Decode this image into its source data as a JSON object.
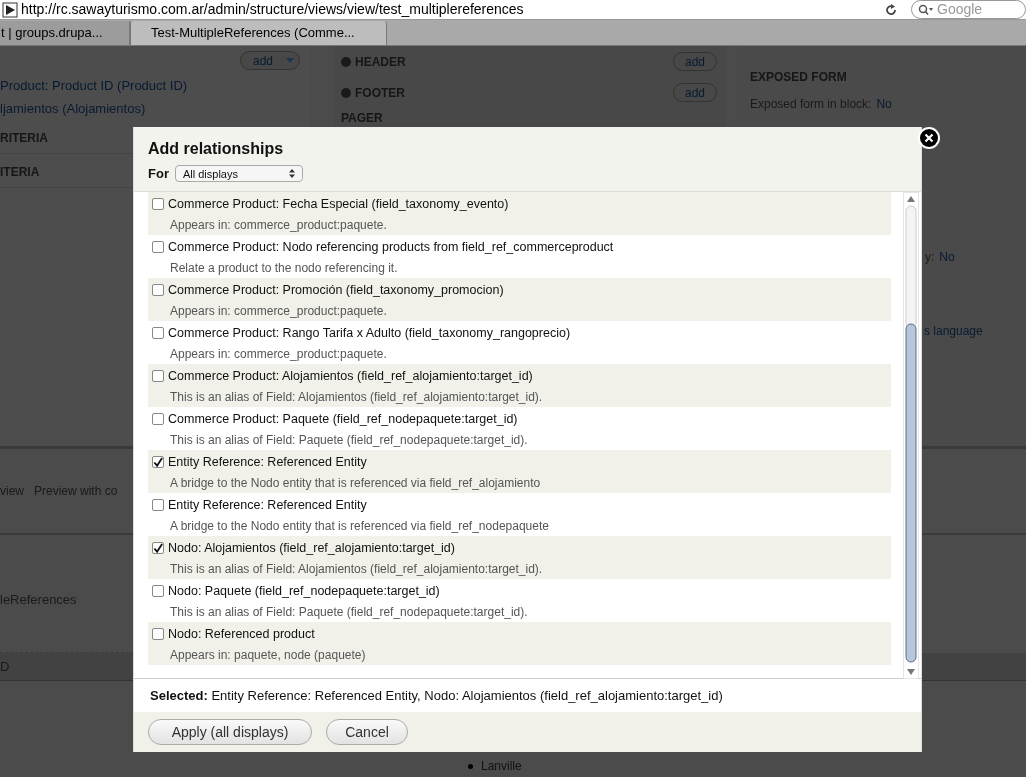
{
  "browser": {
    "url": "http://rc.sawayturismo.com.ar/admin/structure/views/view/test_multiplereferences",
    "search_placeholder": "Google",
    "tabs": [
      {
        "label": "t | groups.drupa...",
        "selected": false
      },
      {
        "label": "Test-MultipleReferences (Comme...",
        "selected": true
      }
    ]
  },
  "background": {
    "left": {
      "add_button": "add",
      "items": [
        "Product: Product ID (Product ID)",
        "ljamientos (Alojamientos)"
      ],
      "headings": [
        "RITERIA",
        "ITERIA"
      ]
    },
    "middle": {
      "sections": [
        {
          "title": "HEADER",
          "button": "add"
        },
        {
          "title": "FOOTER",
          "button": "add"
        }
      ],
      "heading": "PAGER"
    },
    "right": {
      "heading": "EXPOSED FORM",
      "rows": [
        {
          "label": "Exposed form in block:",
          "links": [
            "No"
          ]
        }
      ],
      "fragments": [
        {
          "label": "y:",
          "link": "No"
        },
        {
          "link": "s language"
        }
      ]
    },
    "bottom": {
      "tabs": [
        "view",
        "Preview with co"
      ],
      "title": "leReferences",
      "row": "D",
      "bullet": "Lanville"
    }
  },
  "dialog": {
    "title": "Add relationships",
    "for_label": "For",
    "for_value": "All displays",
    "options": [
      {
        "label": "Commerce Product: Fecha Especial (field_taxonomy_evento)",
        "description": "Appears in: commerce_product:paquete.",
        "checked": false
      },
      {
        "label": "Commerce Product: Nodo referencing products from field_ref_commerceproduct",
        "description": "Relate a product to the nodo referencing it.",
        "checked": false
      },
      {
        "label": "Commerce Product: Promoción (field_taxonomy_promocion)",
        "description": "Appears in: commerce_product:paquete.",
        "checked": false
      },
      {
        "label": "Commerce Product: Rango Tarifa x Adulto (field_taxonomy_rangoprecio)",
        "description": "Appears in: commerce_product:paquete.",
        "checked": false
      },
      {
        "label": "Commerce Product: Alojamientos (field_ref_alojamiento:target_id)",
        "description": "This is an alias of Field: Alojamientos (field_ref_alojamiento:target_id).",
        "checked": false
      },
      {
        "label": "Commerce Product: Paquete (field_ref_nodepaquete:target_id)",
        "description": "This is an alias of Field: Paquete (field_ref_nodepaquete:target_id).",
        "checked": false
      },
      {
        "label": "Entity Reference: Referenced Entity",
        "description": "A bridge to the Nodo entity that is referenced via field_ref_alojamiento",
        "checked": true
      },
      {
        "label": "Entity Reference: Referenced Entity",
        "description": "A bridge to the Nodo entity that is referenced via field_ref_nodepaquete",
        "checked": false
      },
      {
        "label": "Nodo: Alojamientos (field_ref_alojamiento:target_id)",
        "description": "This is an alias of Field: Alojamientos (field_ref_alojamiento:target_id).",
        "checked": true
      },
      {
        "label": "Nodo: Paquete (field_ref_nodepaquete:target_id)",
        "description": "This is an alias of Field: Paquete (field_ref_nodepaquete:target_id).",
        "checked": false
      },
      {
        "label": "Nodo: Referenced product",
        "description": "Appears in: paquete, node (paquete)",
        "checked": false
      }
    ],
    "selected_text": "**Selected:** Entity Reference: Referenced Entity, Nodo: Alojamientos (field_ref_alojamiento:target_id)",
    "buttons": [
      "Apply (all displays)",
      "Cancel"
    ]
  }
}
